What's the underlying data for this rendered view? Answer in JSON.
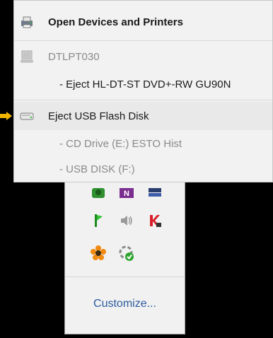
{
  "menu": {
    "items": [
      {
        "label": "Open Devices and Printers",
        "icon": "devices-printers-icon"
      },
      {
        "label": "DTLPT030",
        "icon": "computer-icon"
      },
      {
        "label": "- Eject HL-DT-ST DVD+-RW GU90N"
      },
      {
        "label": "Eject USB Flash Disk",
        "icon": "usb-drive-icon"
      },
      {
        "label": "- CD Drive (E:) ESTO Hist"
      },
      {
        "label": "- USB DISK (F:)"
      }
    ]
  },
  "tray": {
    "icons": [
      "green-app-icon",
      "onenote-icon",
      "display-icon",
      "green-flag-app-icon",
      "volume-icon",
      "kaspersky-icon",
      "flower-app-icon",
      "sync-check-icon"
    ],
    "customize_label": "Customize..."
  },
  "colors": {
    "pointer_arrow": "#f0b400",
    "link": "#2a5a9e"
  }
}
